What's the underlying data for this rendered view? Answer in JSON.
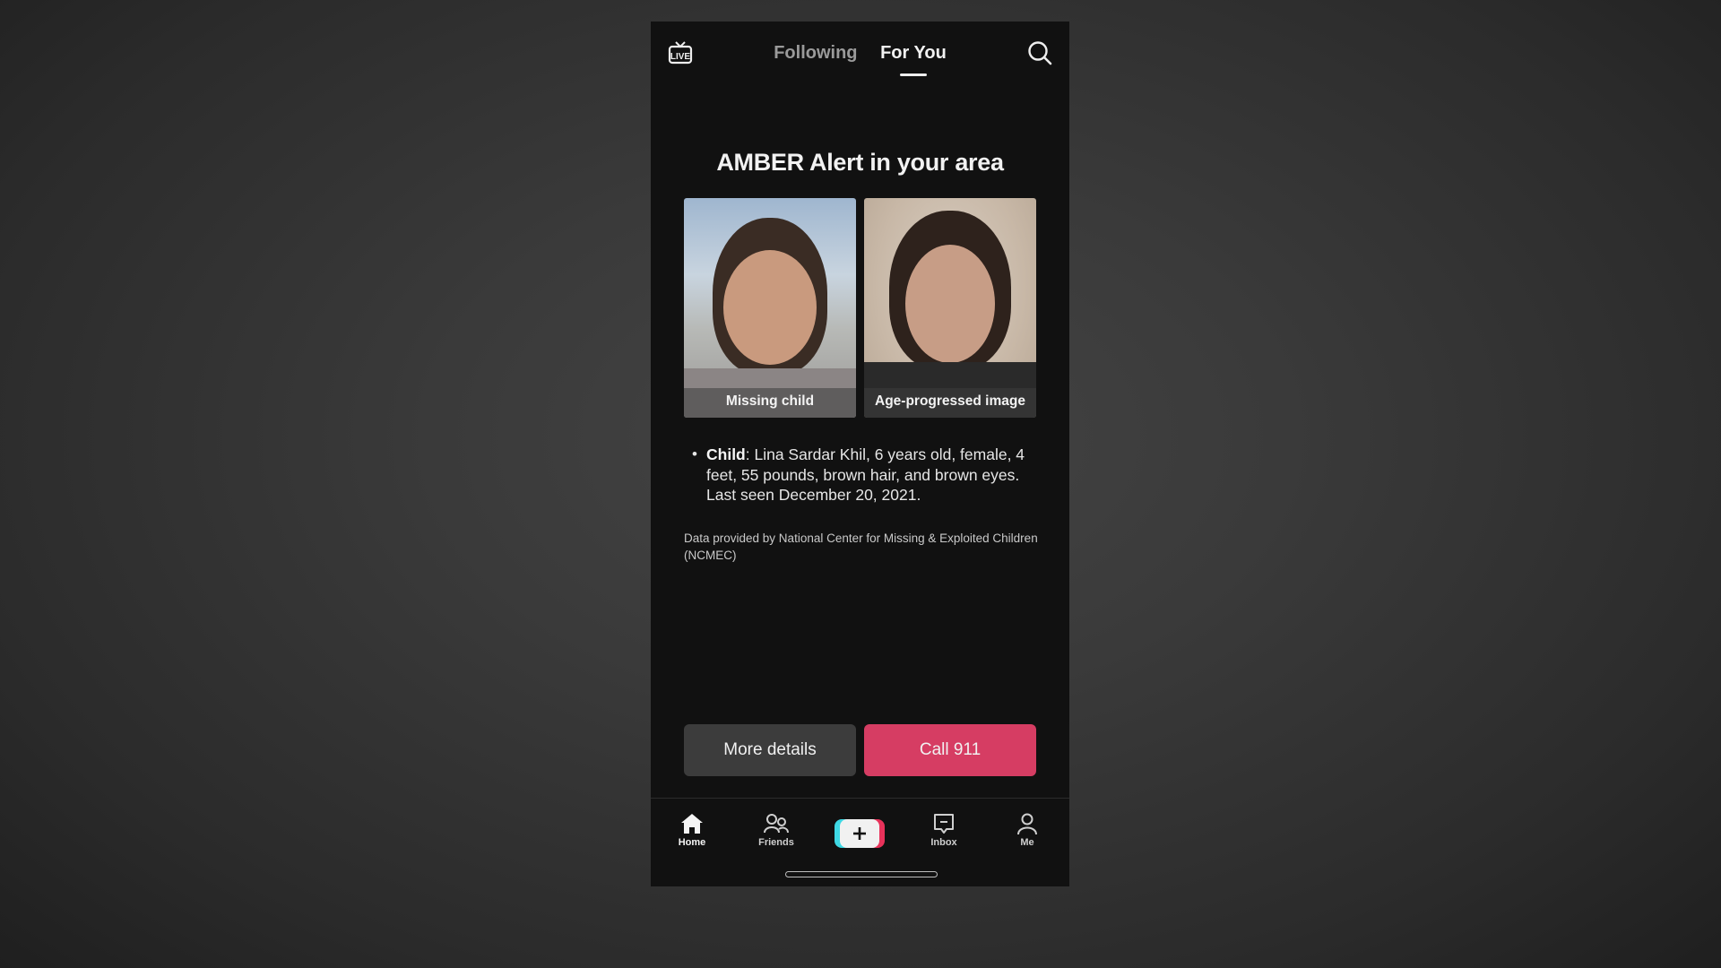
{
  "topbar": {
    "live_icon": "live-tv-icon",
    "tabs": [
      {
        "label": "Following",
        "active": false
      },
      {
        "label": "For You",
        "active": true
      }
    ],
    "search_icon": "search-icon"
  },
  "alert": {
    "title": "AMBER Alert in your area",
    "photos": [
      {
        "caption": "Missing child"
      },
      {
        "caption": "Age-progressed image"
      }
    ],
    "details": {
      "label": "Child",
      "text": ": Lina Sardar Khil, 6 years old, female, 4 feet, 55 pounds, brown hair, and brown eyes. Last seen December 20, 2021."
    },
    "source": "Data provided by National Center for Missing & Exploited Children (NCMEC)"
  },
  "actions": {
    "more_details": "More details",
    "call": "Call 911"
  },
  "colors": {
    "call_button": "#d63d63",
    "secondary_button": "#3c3c3c",
    "app_background": "#111111"
  },
  "bottom_nav": {
    "items": [
      {
        "label": "Home",
        "icon": "home-icon",
        "active": true
      },
      {
        "label": "Friends",
        "icon": "friends-icon",
        "active": false
      },
      {
        "label": "",
        "icon": "create-plus-icon",
        "active": false
      },
      {
        "label": "Inbox",
        "icon": "inbox-icon",
        "active": false
      },
      {
        "label": "Me",
        "icon": "profile-icon",
        "active": false
      }
    ]
  }
}
